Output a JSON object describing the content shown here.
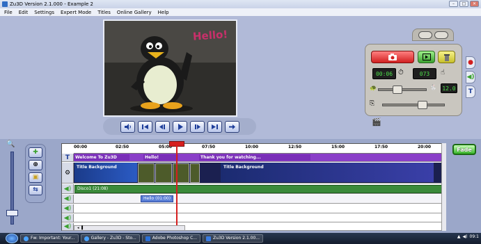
{
  "window": {
    "title": "Zu3D Version 2.1.000 - Example 2",
    "buttons": [
      "–",
      "□",
      "✕"
    ]
  },
  "menu": [
    "File",
    "Edit",
    "Settings",
    "Expert Mode",
    "Titles",
    "Online Gallery",
    "Help"
  ],
  "preview": {
    "overlay_text": "Hello!"
  },
  "control_panel": {
    "timer_value": "00:06",
    "frame_count": "073",
    "speed_value": "12.0"
  },
  "timeline": {
    "ruler_ticks": [
      "00:00",
      "02:50",
      "05:00",
      "07:50",
      "10:00",
      "12:50",
      "15:00",
      "17:50",
      "20:00"
    ],
    "title_clips": [
      "Welcome To Zu3D",
      "Hello!",
      "Thank you for watching..."
    ],
    "background_clips": [
      "Title Background",
      "Title Background"
    ],
    "audio_clips": [
      "Disco1 (21:08)"
    ],
    "audio_labels": [
      "Hello (01:00)"
    ],
    "fade_button_label": "Fade"
  },
  "taskbar": {
    "tasks": [
      "Fw: Important: Your...",
      "Gallery - Zu3D - Sto...",
      "Adobe Photoshop C...",
      "Zu3D Version 2.1.00..."
    ],
    "clock": "09:1"
  }
}
